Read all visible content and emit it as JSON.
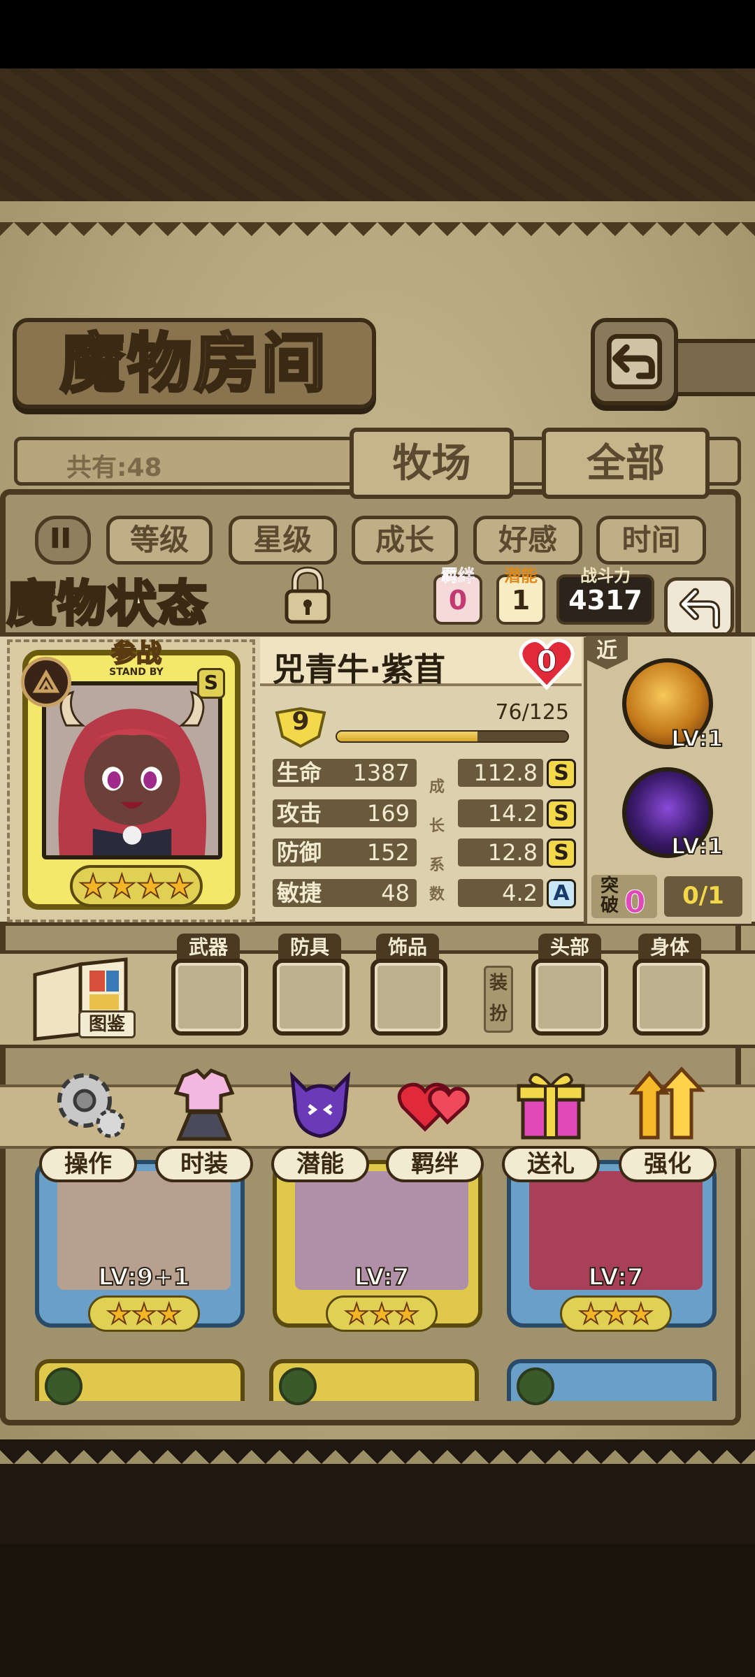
{
  "header": {
    "title": "魔物房间",
    "count_text": "共有:48",
    "tabs": {
      "farm": "牧场",
      "all": "全部"
    }
  },
  "sort": {
    "options": [
      "等级",
      "星级",
      "成长",
      "好感",
      "时间"
    ]
  },
  "status": {
    "title": "魔物状态",
    "bond_label": "羁绊",
    "bond_value": "0",
    "potential_label": "潜能",
    "potential_value": "1",
    "power_label": "战斗力",
    "power_value": "4317"
  },
  "monster": {
    "standby_cn": "参战",
    "standby_en": "STAND BY",
    "rank": "S",
    "stars": 4,
    "name": "兕青牛·紫苜",
    "affection": "0",
    "level": "9",
    "exp_text": "76/125",
    "exp_fraction": 0.608,
    "growth_chars": [
      "成",
      "长",
      "系",
      "数"
    ],
    "stats": [
      {
        "name": "生命",
        "value": "1387",
        "growth": "112.8",
        "grade": "S"
      },
      {
        "name": "攻击",
        "value": "169",
        "growth": "14.2",
        "grade": "S"
      },
      {
        "name": "防御",
        "value": "152",
        "growth": "12.8",
        "grade": "S"
      },
      {
        "name": "敏捷",
        "value": "48",
        "growth": "4.2",
        "grade": "A"
      }
    ],
    "range": "近",
    "skills": [
      {
        "level": "LV:1"
      },
      {
        "level": "LV:1"
      }
    ],
    "break_label": "突破",
    "break_value": "0",
    "break_progress": "0/1"
  },
  "equipment": {
    "codex_label": "图鉴",
    "slots": [
      "武器",
      "防具",
      "饰品",
      "头部",
      "身体"
    ],
    "dress_label": "装扮"
  },
  "actions": [
    "操作",
    "时装",
    "潜能",
    "羁绊",
    "送礼",
    "强化"
  ],
  "monster_list": [
    {
      "level": "LV:9+1",
      "stars": 3
    },
    {
      "level": "LV:7",
      "stars": 3
    },
    {
      "level": "LV:7",
      "stars": 3
    }
  ],
  "colors": {
    "parchment": "#b2a47a",
    "frame": "#4a3a22",
    "gold": "#f3d84a",
    "bond_pink": "#e0447c"
  }
}
